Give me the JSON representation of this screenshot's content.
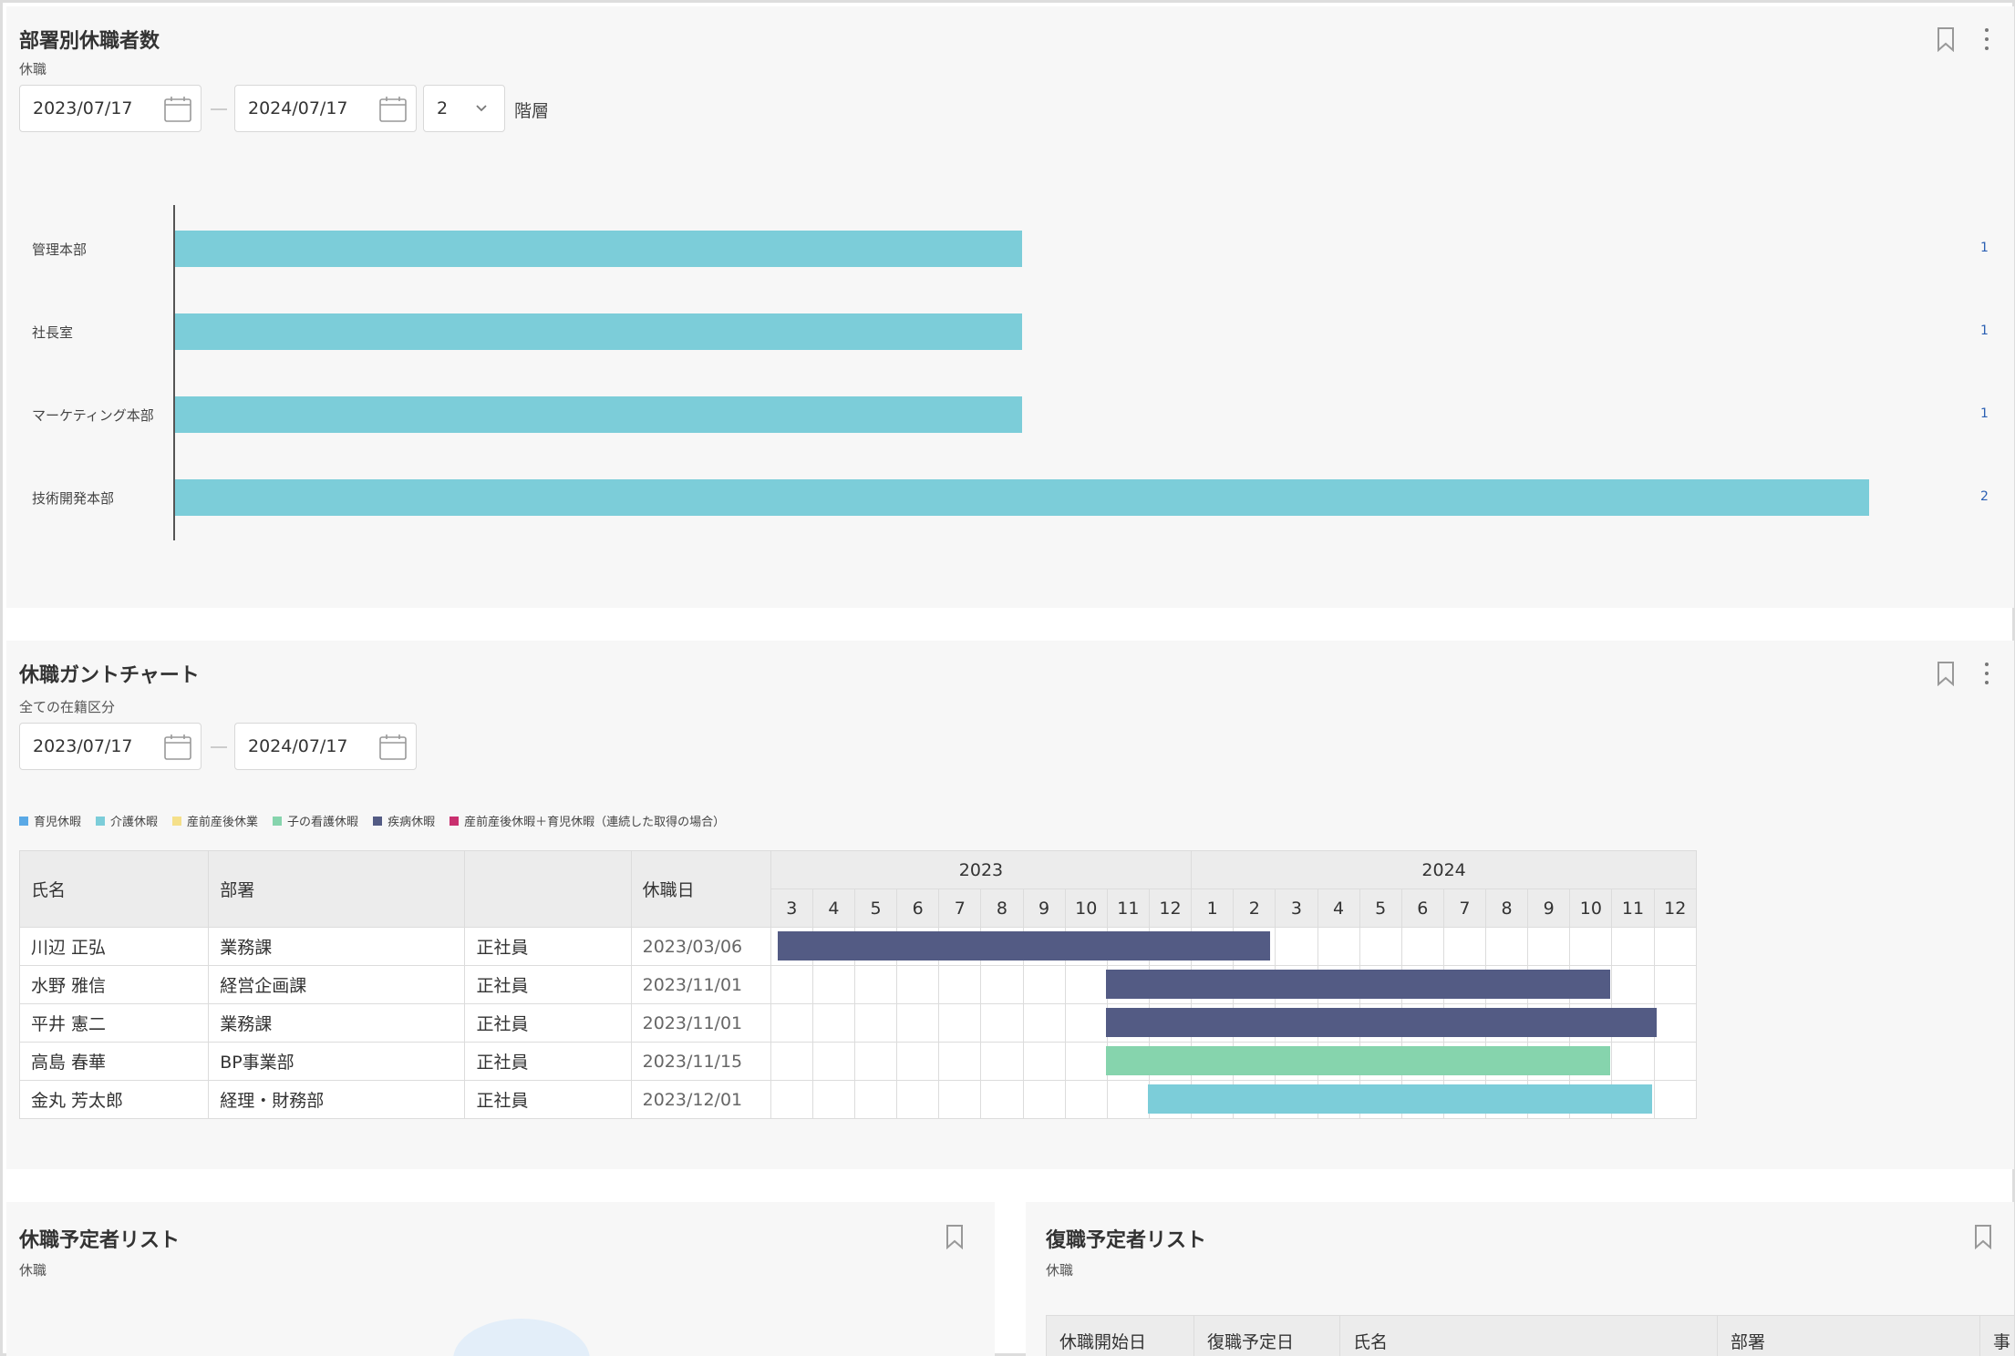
{
  "card1": {
    "title": "部署別休職者数",
    "subtitle": "休職",
    "date_from": "2023/07/17",
    "date_to": "2024/07/17",
    "level_value": "2",
    "level_label": "階層"
  },
  "chart_data": {
    "type": "bar",
    "orientation": "horizontal",
    "categories": [
      "管理本部",
      "社長室",
      "マーケティング本部",
      "技術開発本部"
    ],
    "values": [
      1,
      1,
      1,
      2
    ],
    "xlim": [
      0,
      2
    ],
    "color": "#7ccdd9",
    "grid": false
  },
  "card2": {
    "title": "休職ガントチャート",
    "subtitle": "全ての在籍区分",
    "date_from": "2023/07/17",
    "date_to": "2024/07/17",
    "legend": [
      {
        "label": "育児休暇",
        "color": "#5aa9e6"
      },
      {
        "label": "介護休暇",
        "color": "#7ccdd9"
      },
      {
        "label": "産前産後休業",
        "color": "#f5e08a"
      },
      {
        "label": "子の看護休暇",
        "color": "#86d4ad"
      },
      {
        "label": "疾病休暇",
        "color": "#535b84"
      },
      {
        "label": "産前産後休暇＋育児休暇（連続した取得の場合）",
        "color": "#c9306f"
      }
    ],
    "columns": [
      "氏名",
      "部署",
      "",
      "休職日"
    ],
    "years": [
      "2023",
      "2024"
    ],
    "months": [
      "3",
      "4",
      "5",
      "6",
      "7",
      "8",
      "9",
      "10",
      "11",
      "12",
      "1",
      "2",
      "3",
      "4",
      "5",
      "6",
      "7",
      "8",
      "9",
      "10",
      "11",
      "12"
    ],
    "rows": [
      {
        "name": "川辺 正弘",
        "dept": "業務課",
        "type": "正社員",
        "date": "2023/03/06",
        "start_month": 0.2,
        "end_month": 11.9,
        "color": "#535b84"
      },
      {
        "name": "水野 雅信",
        "dept": "経営企画課",
        "type": "正社員",
        "date": "2023/11/01",
        "start_month": 8.0,
        "end_month": 20.0,
        "color": "#535b84"
      },
      {
        "name": "平井 憲二",
        "dept": "業務課",
        "type": "正社員",
        "date": "2023/11/01",
        "start_month": 8.0,
        "end_month": 21.1,
        "color": "#535b84"
      },
      {
        "name": "高島 春華",
        "dept": "BP事業部",
        "type": "正社員",
        "date": "2023/11/15",
        "start_month": 8.0,
        "end_month": 20.0,
        "color": "#86d4ad"
      },
      {
        "name": "金丸 芳太郎",
        "dept": "経理・財務部",
        "type": "正社員",
        "date": "2023/12/01",
        "start_month": 9.0,
        "end_month": 21.0,
        "color": "#7ccdd9"
      }
    ]
  },
  "card3": {
    "title": "休職予定者リスト",
    "subtitle": "休職"
  },
  "card4": {
    "title": "復職予定者リスト",
    "subtitle": "休職",
    "columns": [
      "休職開始日",
      "復職予定日",
      "氏名",
      "部署",
      "事"
    ]
  },
  "icons": {
    "bookmark": "bookmark-icon",
    "more": "more-vertical-icon",
    "calendar": "calendar-icon",
    "chevron": "chevron-down-icon"
  }
}
